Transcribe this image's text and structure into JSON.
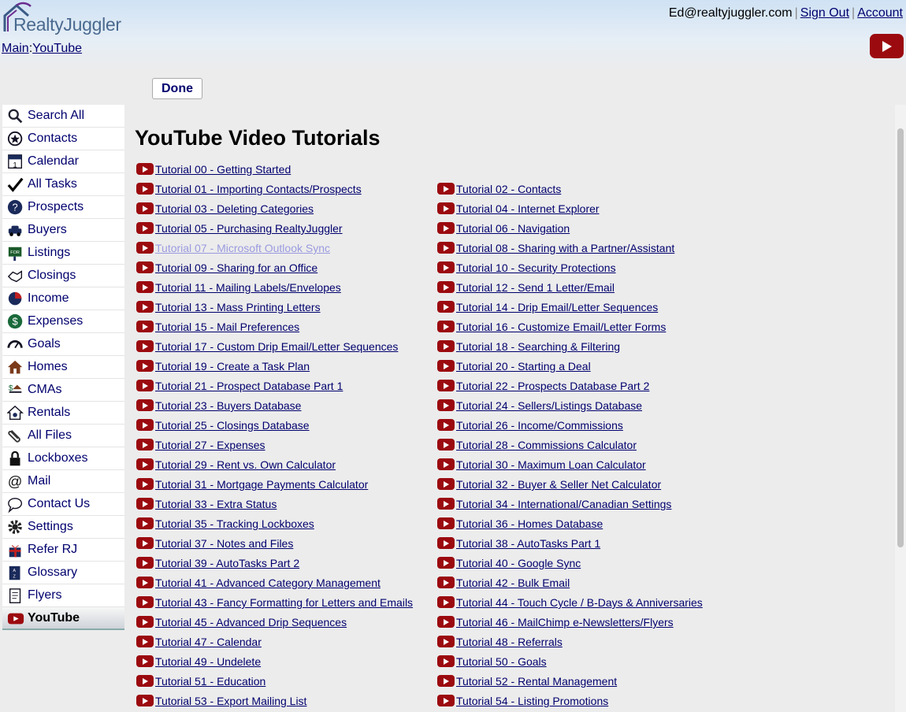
{
  "app": {
    "name": "RealtyJuggler"
  },
  "user": {
    "email": "Ed@realtyjuggler.com",
    "sign_out": "Sign Out",
    "account": "Account"
  },
  "breadcrumb": {
    "main": "Main",
    "sep": ":",
    "current": "YouTube"
  },
  "done_label": "Done",
  "page_title": "YouTube Video Tutorials",
  "sidebar": [
    {
      "label": "Search All",
      "icon": "search-icon"
    },
    {
      "label": "Contacts",
      "icon": "contacts-icon"
    },
    {
      "label": "Calendar",
      "icon": "calendar-icon"
    },
    {
      "label": "All Tasks",
      "icon": "checkmark-icon"
    },
    {
      "label": "Prospects",
      "icon": "prospects-icon"
    },
    {
      "label": "Buyers",
      "icon": "car-icon"
    },
    {
      "label": "Listings",
      "icon": "for-sale-sign-icon"
    },
    {
      "label": "Closings",
      "icon": "handshake-icon"
    },
    {
      "label": "Income",
      "icon": "income-pie-icon"
    },
    {
      "label": "Expenses",
      "icon": "dollar-icon"
    },
    {
      "label": "Goals",
      "icon": "gauge-icon"
    },
    {
      "label": "Homes",
      "icon": "house-icon"
    },
    {
      "label": "CMAs",
      "icon": "cma-scale-icon"
    },
    {
      "label": "Rentals",
      "icon": "rental-house-icon"
    },
    {
      "label": "All Files",
      "icon": "paperclip-icon"
    },
    {
      "label": "Lockboxes",
      "icon": "lock-icon"
    },
    {
      "label": "Mail",
      "icon": "at-sign-icon"
    },
    {
      "label": "Contact Us",
      "icon": "speech-bubble-icon"
    },
    {
      "label": "Settings",
      "icon": "gear-icon"
    },
    {
      "label": "Refer RJ",
      "icon": "gift-icon"
    },
    {
      "label": "Glossary",
      "icon": "glossary-book-icon"
    },
    {
      "label": "Flyers",
      "icon": "flyer-icon"
    },
    {
      "label": "YouTube",
      "icon": "youtube-icon",
      "active": true
    }
  ],
  "tutorials_left": [
    "Tutorial 00 - Getting Started",
    "Tutorial 01 - Importing Contacts/Prospects",
    "Tutorial 03 - Deleting Categories",
    "Tutorial 05 - Purchasing RealtyJuggler",
    "Tutorial 07 - Microsoft Outlook Sync",
    "Tutorial 09 - Sharing for an Office",
    "Tutorial 11 - Mailing Labels/Envelopes",
    "Tutorial 13 - Mass Printing Letters",
    "Tutorial 15 - Mail Preferences",
    "Tutorial 17 - Custom Drip Email/Letter Sequences",
    "Tutorial 19 - Create a Task Plan",
    "Tutorial 21 - Prospect Database Part 1",
    "Tutorial 23 - Buyers Database",
    "Tutorial 25 - Closings Database",
    "Tutorial 27 - Expenses",
    "Tutorial 29 - Rent vs. Own Calculator",
    "Tutorial 31 - Mortgage Payments Calculator",
    "Tutorial 33 - Extra Status",
    "Tutorial 35 - Tracking Lockboxes",
    "Tutorial 37 - Notes and Files",
    "Tutorial 39 - AutoTasks Part 2",
    "Tutorial 41 - Advanced Category Management",
    "Tutorial 43 - Fancy Formatting for Letters and Emails",
    "Tutorial 45 - Advanced Drip Sequences",
    "Tutorial 47 - Calendar",
    "Tutorial 49 - Undelete",
    "Tutorial 51 - Education",
    "Tutorial 53 - Export Mailing List"
  ],
  "tutorials_right": [
    "Tutorial 02 - Contacts",
    "Tutorial 04 - Internet Explorer",
    "Tutorial 06 - Navigation",
    "Tutorial 08 - Sharing with a Partner/Assistant",
    "Tutorial 10 - Security Protections",
    "Tutorial 12 - Send 1 Letter/Email",
    "Tutorial 14 - Drip Email/Letter Sequences",
    "Tutorial 16 - Customize Email/Letter Forms",
    "Tutorial 18 - Searching & Filtering",
    "Tutorial 20 - Starting a Deal",
    "Tutorial 22 - Prospects Database Part 2",
    "Tutorial 24 - Sellers/Listings Database",
    "Tutorial 26 - Income/Commissions",
    "Tutorial 28 - Commissions Calculator",
    "Tutorial 30 - Maximum Loan Calculator",
    "Tutorial 32 - Buyer & Seller Net Calculator",
    "Tutorial 34 - International/Canadian Settings",
    "Tutorial 36 - Homes Database",
    "Tutorial 38 - AutoTasks Part 1",
    "Tutorial 40 - Google Sync",
    "Tutorial 42 - Bulk Email",
    "Tutorial 44 - Touch Cycle / B-Days & Anniversaries",
    "Tutorial 46 - MailChimp e-Newsletters/Flyers",
    "Tutorial 48 - Referrals",
    "Tutorial 50 - Goals",
    "Tutorial 52 - Rental Management",
    "Tutorial 54 - Listing Promotions"
  ],
  "visited_left_index": 4,
  "colors": {
    "link": "#00006e",
    "visited_link": "#9a9ae0",
    "youtube_red": "#9b0a0f",
    "logo_blue": "#4a6a8f",
    "logo_purple": "#6b2c8f"
  }
}
